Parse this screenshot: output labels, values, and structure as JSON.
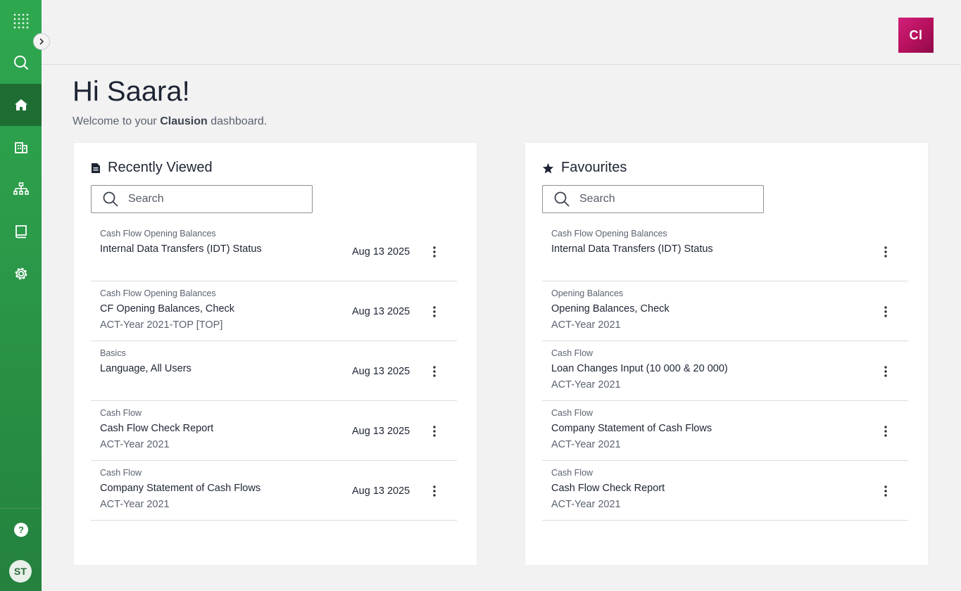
{
  "header": {
    "logo_text": "Cl",
    "greeting": "Hi Saara!"
  },
  "welcome": {
    "prefix": "Welcome to your ",
    "brand": "Clausion",
    "suffix": " dashboard."
  },
  "sidebar": {
    "items": [
      {
        "icon": "apps-grid-icon"
      },
      {
        "icon": "search-icon"
      },
      {
        "icon": "home-icon",
        "active": true
      },
      {
        "icon": "building-icon"
      },
      {
        "icon": "hierarchy-icon"
      },
      {
        "icon": "book-icon"
      },
      {
        "icon": "gear-icon"
      },
      {
        "icon": "help-icon"
      }
    ],
    "avatar_initials": "ST"
  },
  "recent": {
    "title": "Recently Viewed",
    "search_placeholder": "Search",
    "items": [
      {
        "category": "Cash Flow Opening Balances",
        "title": "Internal Data Transfers (IDT) Status",
        "subtitle": "",
        "date": "Aug 13 2025"
      },
      {
        "category": "Cash Flow Opening Balances",
        "title": "CF Opening Balances, Check",
        "subtitle": "ACT-Year 2021-TOP [TOP]",
        "date": "Aug 13 2025"
      },
      {
        "category": "Basics",
        "title": "Language, All Users",
        "subtitle": "",
        "date": "Aug 13 2025"
      },
      {
        "category": "Cash Flow",
        "title": "Cash Flow Check Report",
        "subtitle": "ACT-Year 2021",
        "date": "Aug 13 2025"
      },
      {
        "category": "Cash Flow",
        "title": "Company Statement of Cash Flows",
        "subtitle": "ACT-Year 2021",
        "date": "Aug 13 2025"
      }
    ]
  },
  "favourites": {
    "title": "Favourites",
    "search_placeholder": "Search",
    "items": [
      {
        "category": "Cash Flow Opening Balances",
        "title": "Internal Data Transfers (IDT) Status",
        "subtitle": ""
      },
      {
        "category": "Opening Balances",
        "title": "Opening Balances, Check",
        "subtitle": "ACT-Year 2021"
      },
      {
        "category": "Cash Flow",
        "title": "Loan Changes Input (10 000 & 20 000)",
        "subtitle": "ACT-Year 2021"
      },
      {
        "category": "Cash Flow",
        "title": "Company Statement of Cash Flows",
        "subtitle": "ACT-Year 2021"
      },
      {
        "category": "Cash Flow",
        "title": "Cash Flow Check Report",
        "subtitle": "ACT-Year 2021"
      }
    ]
  },
  "colors": {
    "sidebar": "#2b9a49",
    "sidebar_active": "#1e6e33",
    "brand": "#c0166a"
  }
}
